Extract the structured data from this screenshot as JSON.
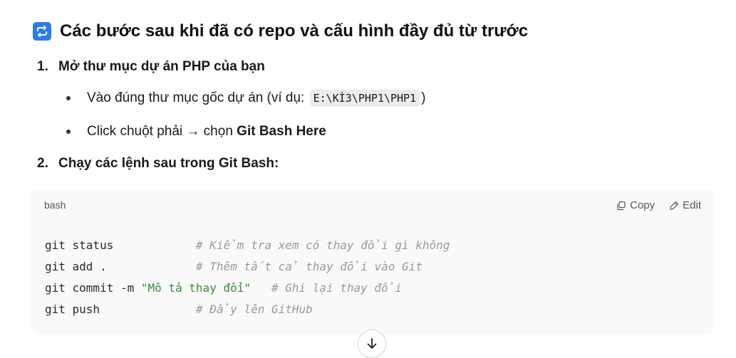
{
  "heading": {
    "text": "Các bước sau khi đã có repo và cấu hình đầy đủ từ trước"
  },
  "steps": [
    {
      "num": "1.",
      "text": "Mở thư mục dự án PHP của bạn"
    },
    {
      "num": "2.",
      "text": "Chạy các lệnh sau trong Git Bash:"
    }
  ],
  "bullets": {
    "b1_before": "Vào đúng thư mục gốc dự án (ví dụ: ",
    "b1_code": "E:\\KÌ3\\PHP1\\PHP1",
    "b1_after": ")",
    "b2_before": "Click chuột phải → chọn ",
    "b2_strong": "Git Bash Here"
  },
  "code": {
    "lang": "bash",
    "copy_label": "Copy",
    "edit_label": "Edit",
    "lines": [
      {
        "cmd": "git status",
        "comment": "# Kiểm tra xem có thay đổi gì không"
      },
      {
        "cmd": "git add .",
        "comment": "# Thêm tất cả thay đổi vào Git"
      },
      {
        "cmd_prefix": "git commit -m ",
        "cmd_string": "\"Mô tả thay đổi\"",
        "comment": "# Ghi lại thay đổi"
      },
      {
        "cmd": "git push",
        "comment": "# Đẩy lên GitHub"
      }
    ]
  },
  "colors": {
    "accent": "#2b7de9",
    "string": "#3a8b3a",
    "comment": "#9a9a9a"
  },
  "icons": {
    "heading": "repeat-icon",
    "copy": "copy-icon",
    "edit": "edit-icon",
    "scroll": "arrow-down-icon"
  }
}
